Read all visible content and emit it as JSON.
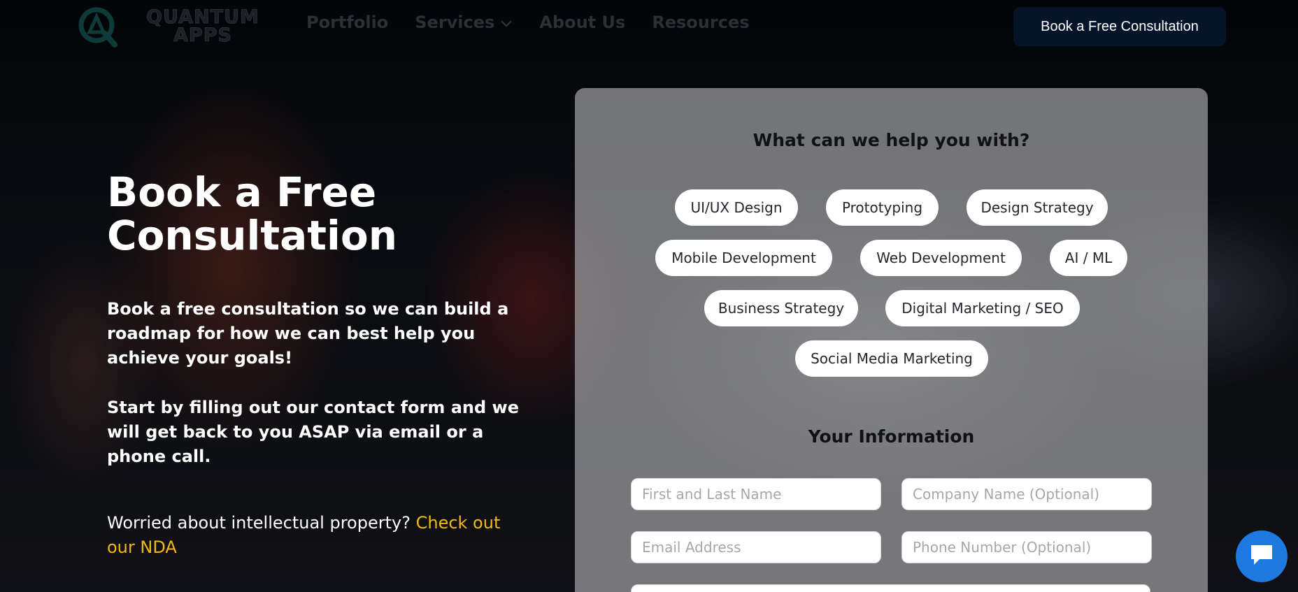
{
  "header": {
    "logo_text": "QUANTUM APPS",
    "nav": [
      {
        "label": "Portfolio"
      },
      {
        "label": "Services"
      },
      {
        "label": "About Us"
      },
      {
        "label": "Resources"
      }
    ],
    "cta_label": "Book a Free Consultation"
  },
  "hero": {
    "title_line1": "Book a Free",
    "title_line2": "Consultation",
    "paragraph1": "Book a free consultation so we can build a roadmap for how we can best help you achieve your goals!",
    "paragraph2": "Start by filling out our contact form and we will get back to you ASAP via email or a phone call.",
    "ip_text": "Worried about intellectual property?",
    "ip_link": "Check out our NDA"
  },
  "form": {
    "help_title": "What can we help you with?",
    "services": [
      "UI/UX Design",
      "Prototyping",
      "Design Strategy",
      "Mobile Development",
      "Web Development",
      "AI / ML",
      "Business Strategy",
      "Digital Marketing / SEO",
      "Social Media Marketing"
    ],
    "info_title": "Your Information",
    "fields": {
      "name_placeholder": "First and Last Name",
      "company_placeholder": "Company Name (Optional)",
      "email_placeholder": "Email Address",
      "phone_placeholder": "Phone Number (Optional)"
    }
  },
  "colors": {
    "accent_link": "#f5b90e",
    "cta_bg": "#06142a",
    "chat_bg": "#1f7ae0"
  },
  "icons": {
    "logo": "quantum-logo-icon",
    "services_dropdown": "chevron-down-icon",
    "chat": "chat-bubble-icon"
  }
}
